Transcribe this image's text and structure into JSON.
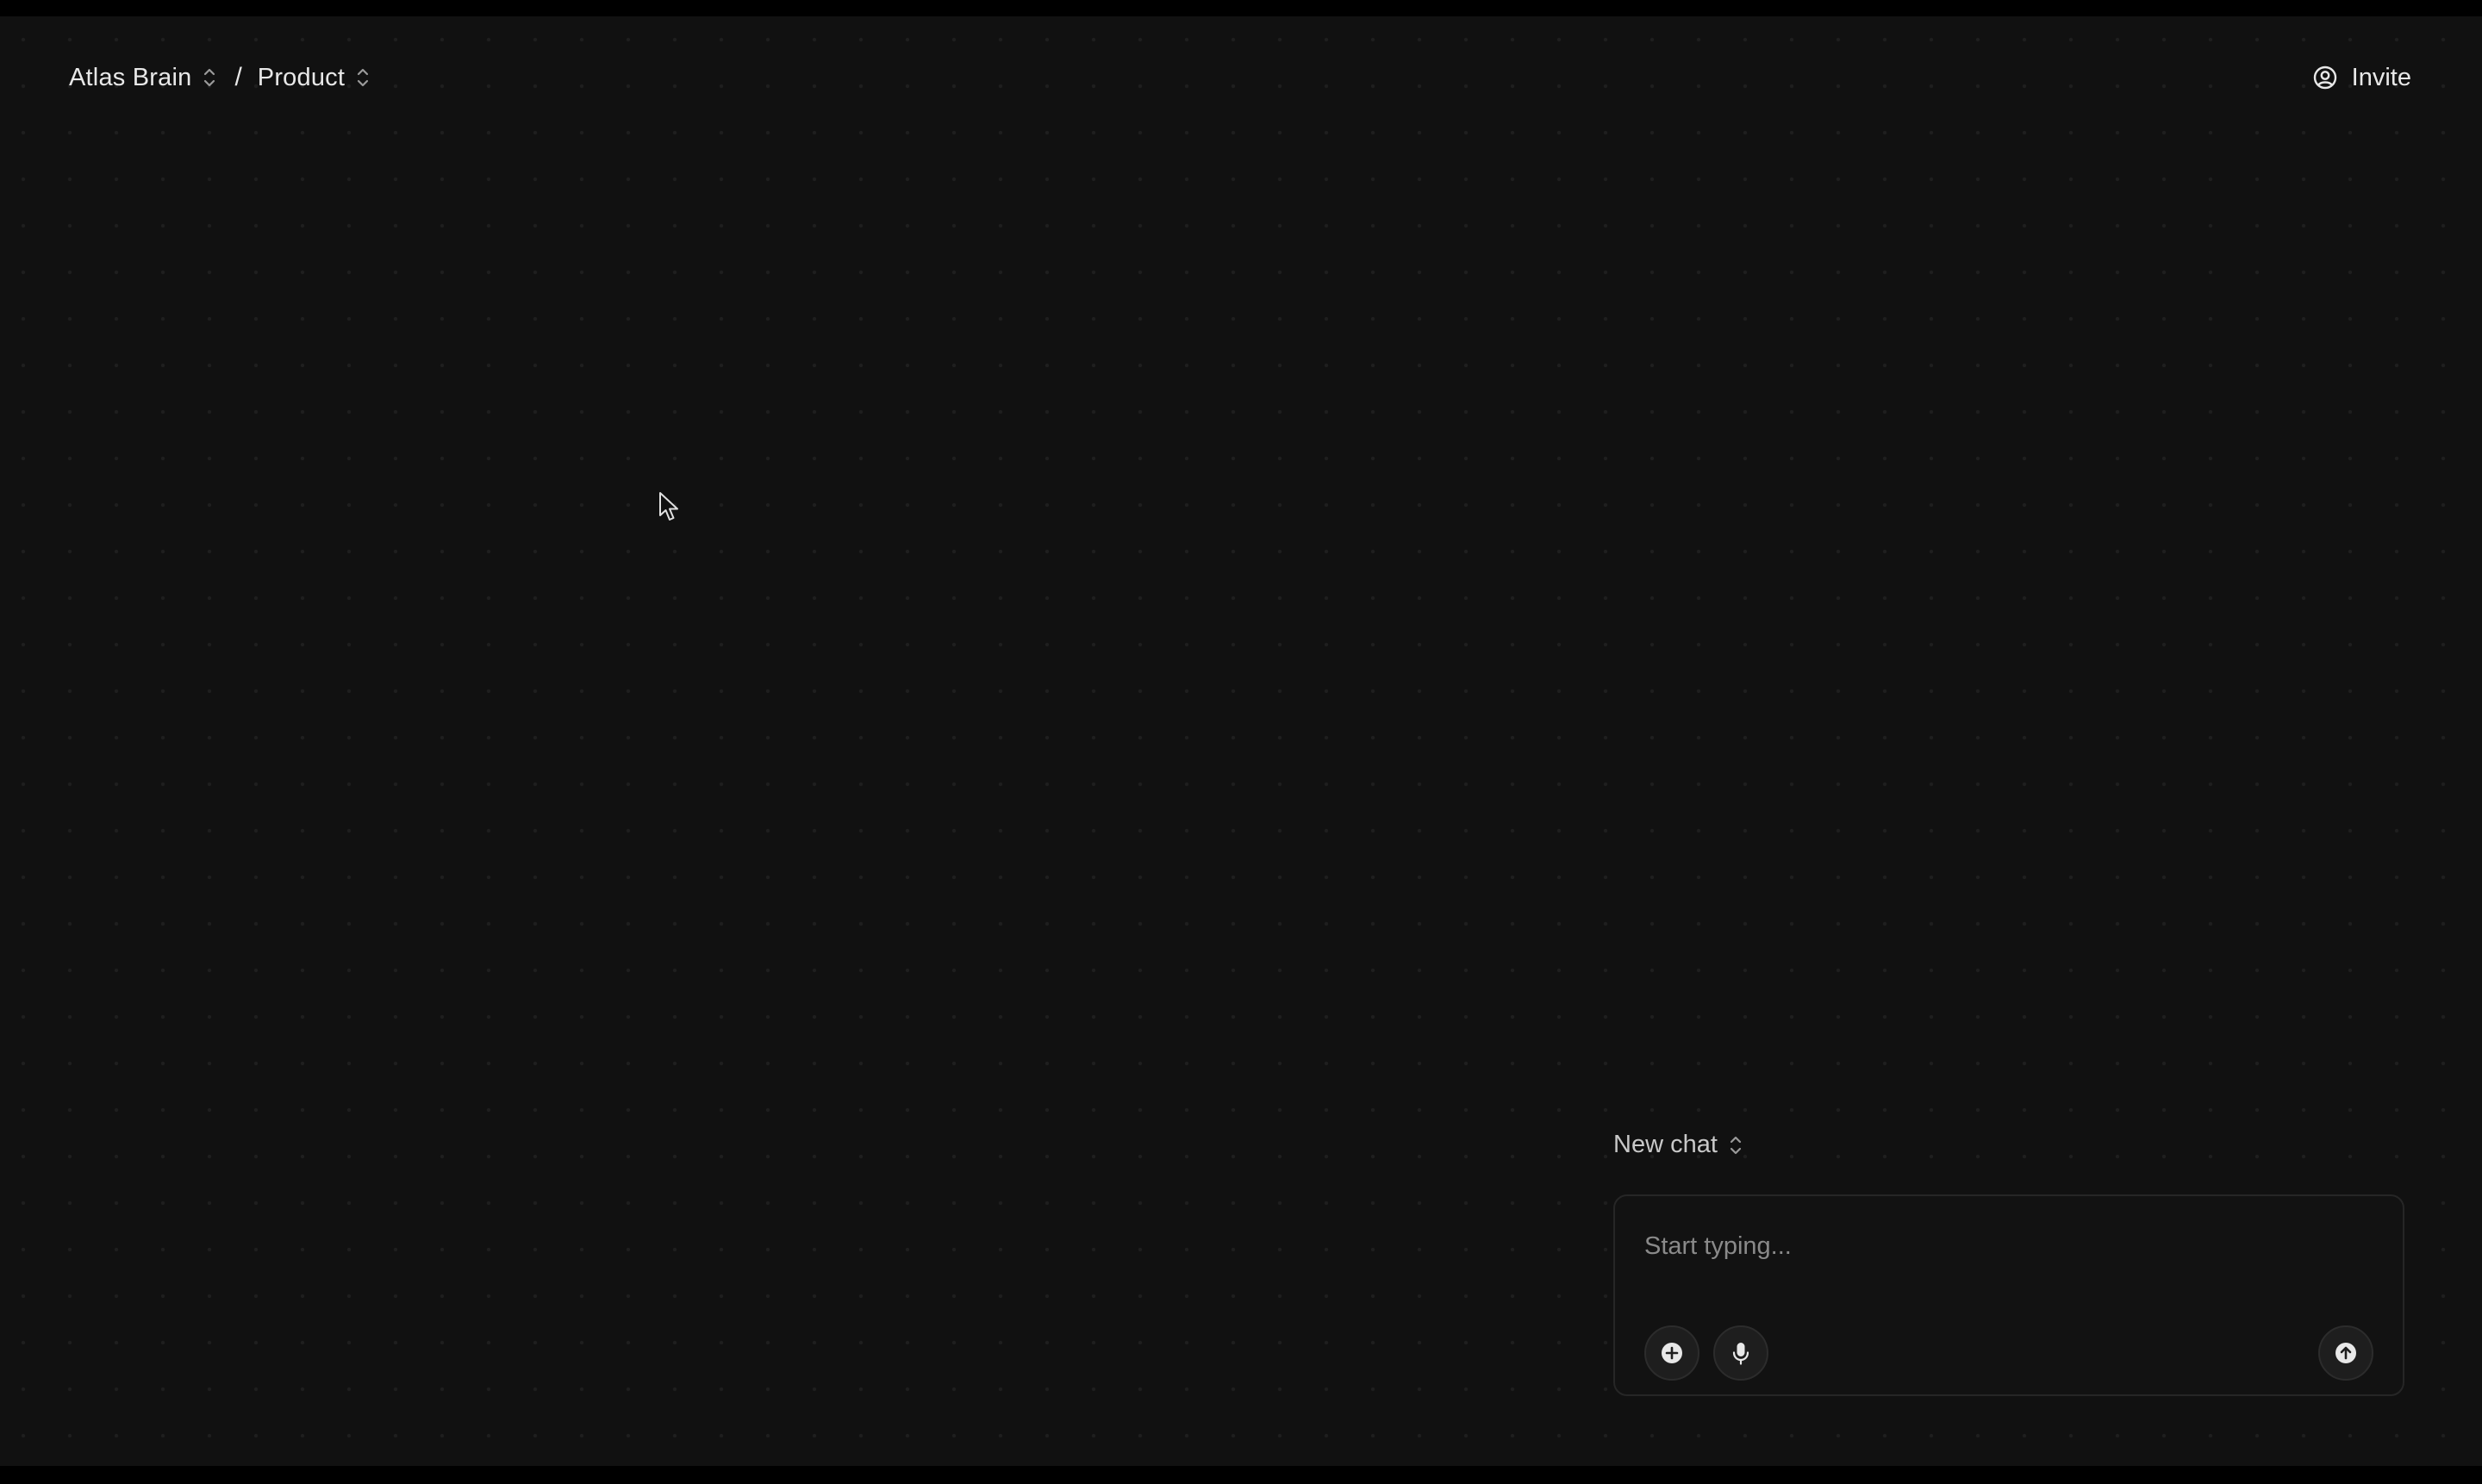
{
  "breadcrumb": {
    "workspace": "Atlas Brain",
    "separator": "/",
    "project": "Product"
  },
  "header": {
    "invite_label": "Invite"
  },
  "chat": {
    "selector_label": "New chat",
    "input_placeholder": "Start typing...",
    "input_value": ""
  },
  "icons": {
    "workspace_switch": "updown-chevron-icon",
    "project_switch": "updown-chevron-icon",
    "invite": "user-circle-icon",
    "chat_switch": "updown-chevron-icon",
    "add": "plus-circle-icon",
    "mic": "microphone-icon",
    "send": "arrow-up-circle-icon",
    "cursor": "mouse-pointer-icon"
  },
  "colors": {
    "background": "#111111",
    "dot_grid": "#1f1f1f",
    "text_primary": "#e8e8e8",
    "text_placeholder": "#8a8a8a",
    "composer_border": "#262626"
  }
}
